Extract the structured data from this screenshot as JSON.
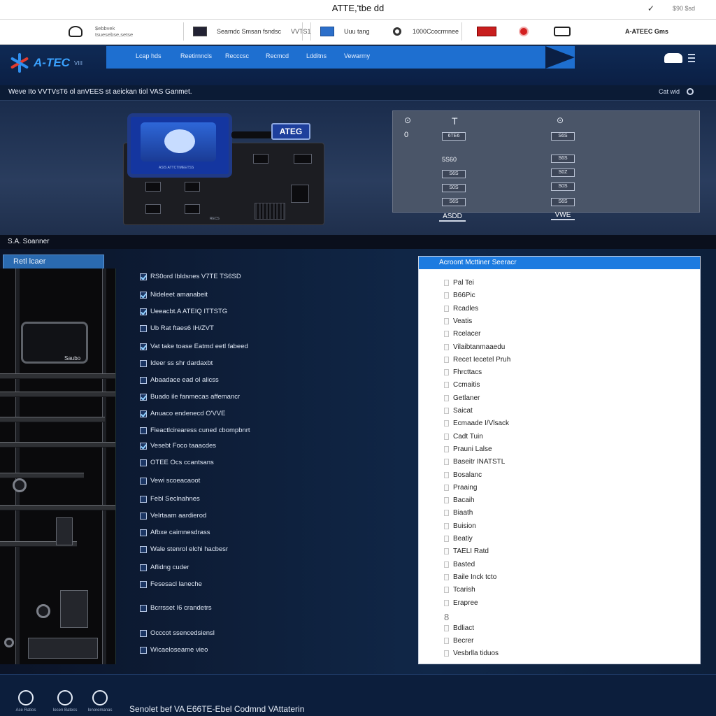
{
  "window": {
    "title": "ATTE,'tbe dd",
    "right_icon": "✓",
    "right_text": "$90 $sd"
  },
  "toolbar": {
    "account_line1": "$ebbvek",
    "account_line2": "tsuesebse,setse",
    "search_label": "Seamdc Smsan fsndsc",
    "search_value": "VVTS1",
    "mode_label": "Uuu tang",
    "count_label": "1000Ccocrmnee",
    "brand": "A-ATEEC Gms"
  },
  "nav": {
    "logo_text": "A-TEC",
    "logo_sub": "VIII",
    "items": [
      "Lcap hds",
      "Reetirnncls",
      "Recccsc",
      "Recmcd",
      "Ldditns",
      "Vewarmy"
    ]
  },
  "headline": {
    "text": "Weve Ito VVTVsT6 ol anVEES st aeickan tiol VAS Ganmet.",
    "right_label": "Cat wid"
  },
  "hero": {
    "device_tag": "ATEG",
    "screen_caption": "ASIS ATTCTIMEETSS",
    "plate": "RECS",
    "panel": {
      "col1_icon": "⊙",
      "col1_value": "0",
      "col2_head": "T",
      "col3_icon": "⊙",
      "col2_cells": [
        "6TE6",
        "5S60",
        "S6S",
        "S0S",
        "S6S"
      ],
      "col2_label": "5S60",
      "col3_cells": [
        "S6S",
        "S6S",
        "S0Z",
        "S0S",
        "S6S"
      ],
      "btn_left": "ASDD",
      "btn_right": "VWE"
    }
  },
  "section": {
    "label": "S.A. Soanner"
  },
  "filters": {
    "tab_label": "Retl lcaer",
    "items": [
      "RS0ord Ibldsnes V7TE TS6SD",
      "Nideleet amanabeit",
      "Ueeacbt.A ATEIQ ITTSTG",
      "Ub Rat ftaes6 IH/ZVT",
      "Vat take toase Eatmd eetl fabeed",
      "Ideer ss shr dardaxbt",
      "Abaadace ead ol alicss",
      "Buado ile fanmecas affemancr",
      "Anuaco endenecd O'VVE",
      "Fieactlcirearess cuned cbompbnrt",
      "Vesebt Foco taaacdes",
      "OTEE Ocs ccantsans",
      "Vewi scoeacaoot",
      "Febl Seclnahnes",
      "Velrtaam aardierod",
      "Afbxe caimnesdrass",
      "Wale stenrol elchi hacbesr",
      "Aflidng cuder",
      "Fesesacl laneche",
      "Bcrrsset I6 crandetrs",
      "Occcot ssencedsiensl",
      "Wicaeloseame vieo"
    ],
    "checked": [
      true,
      true,
      true,
      false,
      true,
      false,
      false,
      true,
      true,
      false,
      true,
      false,
      false,
      false,
      false,
      false,
      false,
      false,
      false,
      false,
      false,
      false
    ]
  },
  "sorter": {
    "header": "Acroont Mcttiner Seeracr",
    "items": [
      "Pal Tei",
      "B66Pic",
      "Rcadles",
      "Veatis",
      "Rcelacer",
      "Vilaibtanmaaedu",
      "Recet Iecetel Pruh",
      "Fhrcttacs",
      "Ccmaitis",
      "Getlaner",
      "Saicat",
      "Ecmaade I/Vlsack",
      "Cadt Tuin",
      "Prauni Lalse",
      "Baseitr INATSTL",
      "Bosalanc",
      "Praaing",
      "Bacaih",
      "Biaath",
      "Buision",
      "Beatiy",
      "TAELI Ratd",
      "Basted",
      "Baile Inck tcto",
      "Tcarish",
      "Erapree",
      "Bdliact",
      "Becrer",
      "Vesbrlla tiduos"
    ],
    "gap_mark": "8"
  },
  "footer": {
    "icon_labels": [
      "Ace Ratios",
      "Iecen Batecs",
      "Ionoremanas"
    ],
    "text": "Senolet bef VA E66TE-Ebel Codmnd VAttaterin"
  }
}
